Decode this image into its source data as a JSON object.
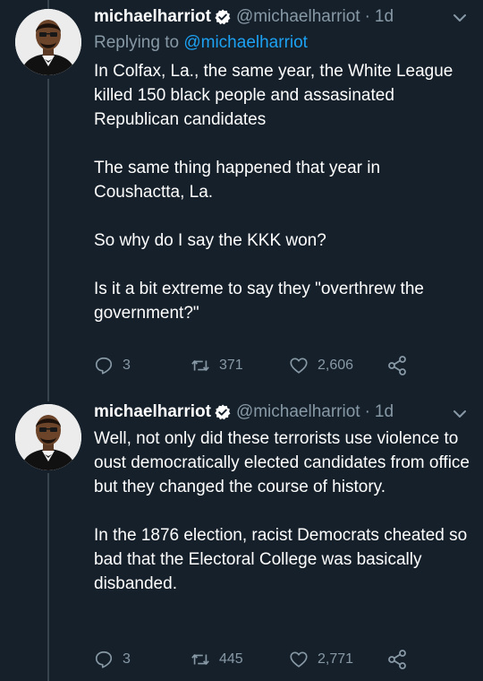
{
  "tweets": [
    {
      "author": {
        "name": "michaelharriot",
        "handle": "@michaelharriot",
        "avatar": "profile-photo"
      },
      "separator": "·",
      "time": "1d",
      "replying_prefix": "Replying to",
      "replying_to": "@michaelharriot",
      "paragraphs": [
        "In Colfax, La., the same year, the White League killed 150 black people and assasinated Republican candidates",
        "The same thing happened that year in Coushactta, La.",
        "So why do I say the KKK won?",
        "Is it a bit extreme to say they \"overthrew the government?\""
      ],
      "stats": {
        "replies": "3",
        "retweets": "371",
        "likes": "2,606"
      }
    },
    {
      "author": {
        "name": "michaelharriot",
        "handle": "@michaelharriot",
        "avatar": "profile-photo"
      },
      "separator": "·",
      "time": "1d",
      "paragraphs": [
        "Well, not only did these terrorists use violence to oust democratically elected candidates from office but they changed the course of history.",
        "In the 1876 election,  racist Democrats cheated so bad that the Electoral College was basically disbanded."
      ],
      "stats": {
        "replies": "3",
        "retweets": "445",
        "likes": "2,771"
      }
    }
  ],
  "icons": {
    "verified": "verified-badge-icon",
    "menu": "chevron-down-icon",
    "reply": "reply-icon",
    "retweet": "retweet-icon",
    "like": "heart-icon",
    "share": "share-icon"
  },
  "colors": {
    "background": "#15202b",
    "text": "#ffffff",
    "secondary": "#8899a6",
    "accent": "#1da1f2",
    "thread_line": "#38444d"
  }
}
